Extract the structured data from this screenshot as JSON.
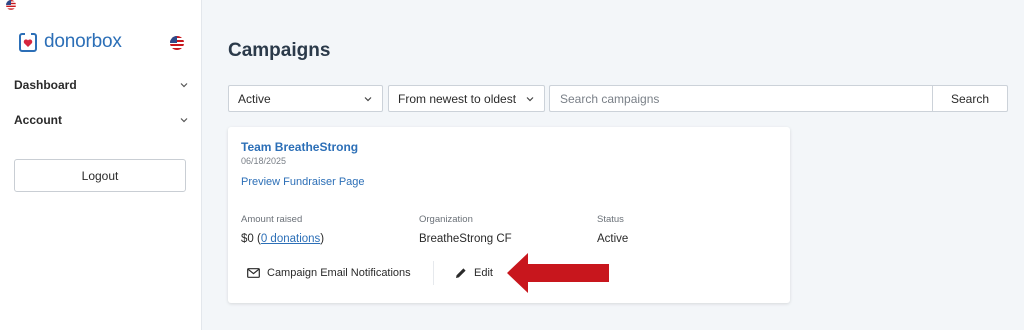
{
  "sidebar": {
    "brand": "donorbox",
    "nav": [
      {
        "label": "Dashboard"
      },
      {
        "label": "Account"
      }
    ],
    "logout_label": "Logout"
  },
  "main": {
    "title": "Campaigns",
    "filters": {
      "status_value": "Active",
      "sort_value": "From newest to oldest"
    },
    "search": {
      "placeholder": "Search campaigns",
      "button_label": "Search"
    }
  },
  "campaign": {
    "name": "Team BreatheStrong",
    "date": "06/18/2025",
    "preview_label": "Preview Fundraiser Page",
    "stats": {
      "amount_label": "Amount raised",
      "amount_value": "$0",
      "amount_open": " (",
      "donations_link": "0 donations",
      "amount_close": ")",
      "org_label": "Organization",
      "org_value": "BreatheStrong CF",
      "status_label": "Status",
      "status_value": "Active"
    },
    "actions": {
      "email_label": "Campaign Email Notifications",
      "edit_label": "Edit"
    }
  },
  "colors": {
    "brand_blue": "#2c6fb7",
    "annotation_arrow": "#c8161d",
    "page_bg": "#f3f6f9"
  },
  "icons": [
    "us-flag-icon",
    "donorbox-logo-icon",
    "chevron-down-icon",
    "mail-icon",
    "pencil-icon",
    "arrow-annotation"
  ]
}
